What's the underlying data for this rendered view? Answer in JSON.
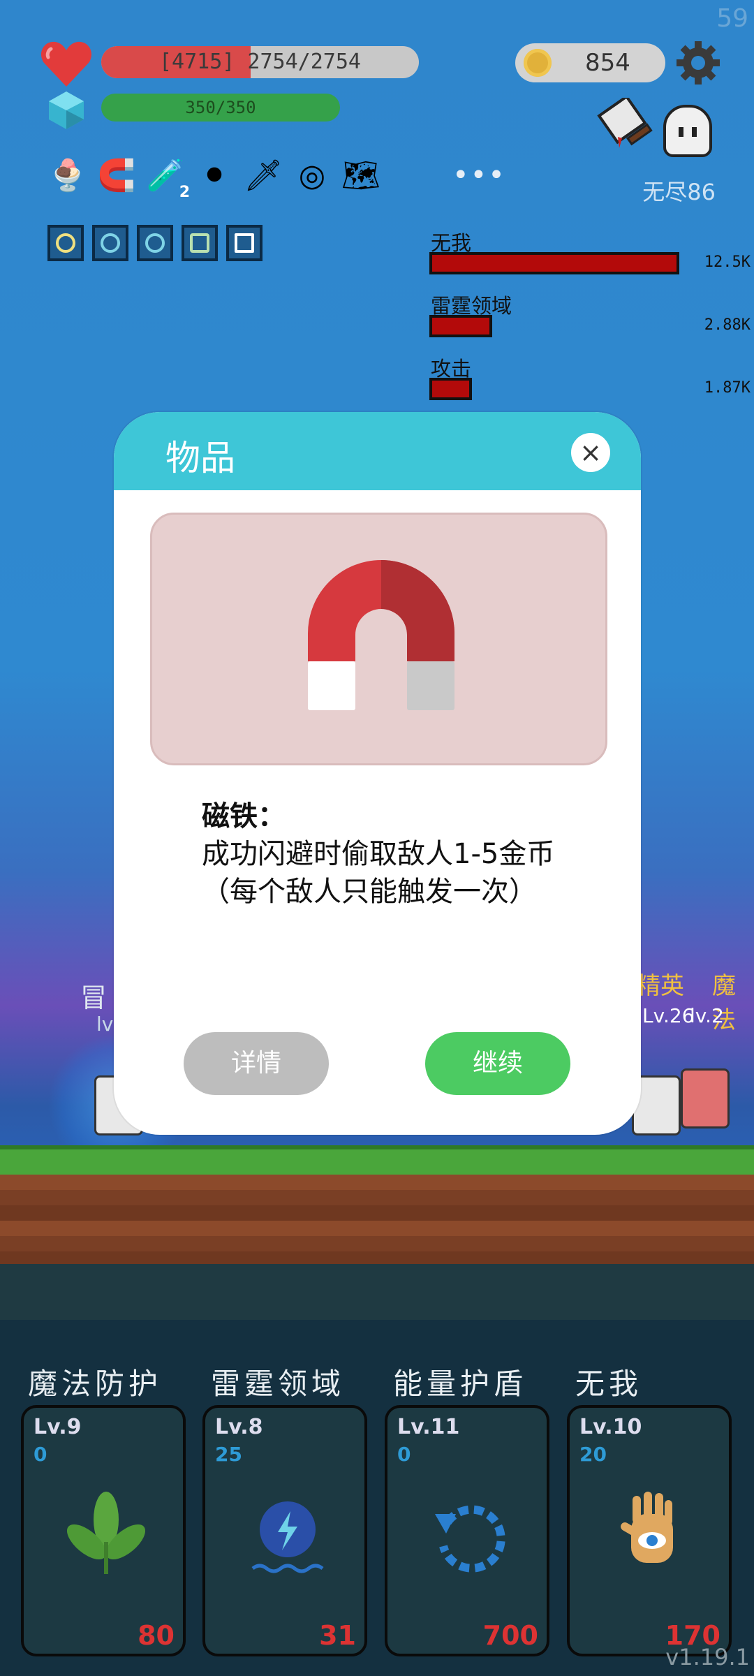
{
  "hud": {
    "fps": "59",
    "hp_text": "[4715] 2754/2754",
    "hp_fraction": 0.47,
    "mp_text": "350/350",
    "coins": "854",
    "stage": "无尽86",
    "more": "•••",
    "items": [
      {
        "icon": "ice-cream-icon",
        "glyph": "🍨"
      },
      {
        "icon": "magnet-icon",
        "glyph": "🧲"
      },
      {
        "icon": "potion-icon",
        "glyph": "🧪",
        "badge": "2"
      },
      {
        "icon": "cauldron-icon",
        "glyph": "⚫"
      },
      {
        "icon": "sword-icon",
        "glyph": "🗡"
      },
      {
        "icon": "target-rune-icon",
        "glyph": "◎"
      },
      {
        "icon": "treasure-map-icon",
        "glyph": "🗺"
      }
    ]
  },
  "damage": [
    {
      "name": "无我",
      "value": "12.5K",
      "fraction": 1.0
    },
    {
      "name": "雷霆领域",
      "value": "2.88K",
      "fraction": 0.25
    },
    {
      "name": "攻击",
      "value": "1.87K",
      "fraction": 0.17
    }
  ],
  "battle": {
    "enemy_lvl": "Lv.26",
    "enemy_name_1": "精英",
    "enemy_name_2": "魔法",
    "enemy_left": "冒",
    "enemy_left_lvl": "lv",
    "enemy_right_lvl": "lv.2"
  },
  "dialog": {
    "title": "物品",
    "close": "×",
    "item_name": "磁铁：",
    "item_desc": "成功闪避时偷取敌人1-5金币（每个敌人只能触发一次）",
    "btn_detail": "详情",
    "btn_continue": "继续"
  },
  "skills": [
    {
      "name": "魔法防护",
      "level": "Lv.9",
      "cost": "0",
      "count": "80",
      "icon": "leaf-icon"
    },
    {
      "name": "雷霆领域",
      "level": "Lv.8",
      "cost": "25",
      "count": "31",
      "icon": "lightning-gear-icon"
    },
    {
      "name": "能量护盾",
      "level": "Lv.11",
      "cost": "0",
      "count": "700",
      "icon": "rotate-arrow-icon"
    },
    {
      "name": "无我",
      "level": "Lv.10",
      "cost": "20",
      "count": "170",
      "icon": "eye-hand-icon"
    }
  ],
  "version": "v1.19.1"
}
